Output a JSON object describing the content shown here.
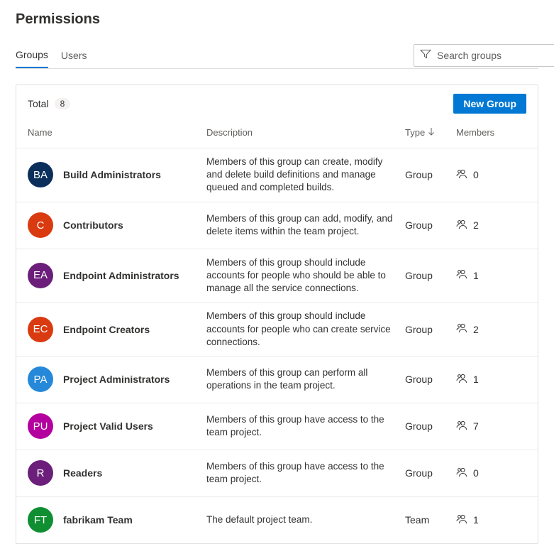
{
  "title": "Permissions",
  "tabs": {
    "groups": "Groups",
    "users": "Users"
  },
  "search": {
    "placeholder": "Search groups"
  },
  "summary": {
    "total_label": "Total",
    "total_count": "8"
  },
  "buttons": {
    "new_group": "New Group"
  },
  "columns": {
    "name": "Name",
    "description": "Description",
    "type": "Type",
    "members": "Members"
  },
  "groups": [
    {
      "initials": "BA",
      "avatar_color": "#0b2e5b",
      "name": "Build Administrators",
      "description": "Members of this group can create, modify and delete build definitions and manage queued and completed builds.",
      "type": "Group",
      "members": "0"
    },
    {
      "initials": "C",
      "avatar_color": "#d93a0f",
      "name": "Contributors",
      "description": "Members of this group can add, modify, and delete items within the team project.",
      "type": "Group",
      "members": "2"
    },
    {
      "initials": "EA",
      "avatar_color": "#6b1f7a",
      "name": "Endpoint Administrators",
      "description": "Members of this group should include accounts for people who should be able to manage all the service connections.",
      "type": "Group",
      "members": "1"
    },
    {
      "initials": "EC",
      "avatar_color": "#d93a0f",
      "name": "Endpoint Creators",
      "description": "Members of this group should include accounts for people who can create service connections.",
      "type": "Group",
      "members": "2"
    },
    {
      "initials": "PA",
      "avatar_color": "#2588d8",
      "name": "Project Administrators",
      "description": "Members of this group can perform all operations in the team project.",
      "type": "Group",
      "members": "1"
    },
    {
      "initials": "PU",
      "avatar_color": "#b4009e",
      "name": "Project Valid Users",
      "description": "Members of this group have access to the team project.",
      "type": "Group",
      "members": "7"
    },
    {
      "initials": "R",
      "avatar_color": "#6b1f7a",
      "name": "Readers",
      "description": "Members of this group have access to the team project.",
      "type": "Group",
      "members": "0"
    },
    {
      "initials": "FT",
      "avatar_color": "#0f8f32",
      "name": "fabrikam Team",
      "description": "The default project team.",
      "type": "Team",
      "members": "1"
    }
  ]
}
